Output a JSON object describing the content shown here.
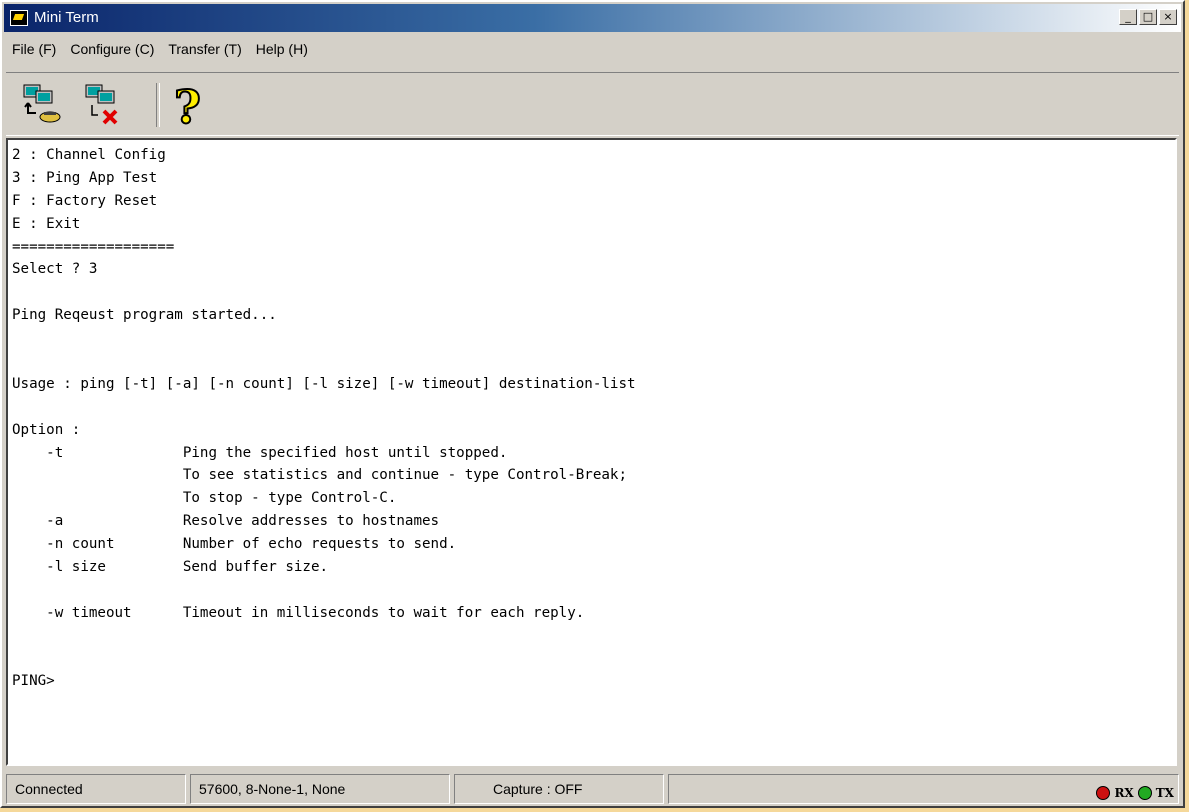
{
  "window": {
    "title": "Mini Term",
    "controls": [
      "_",
      "□",
      "×"
    ]
  },
  "menu": [
    {
      "label": "File (F)"
    },
    {
      "label": "Configure (C)"
    },
    {
      "label": "Transfer (T)"
    },
    {
      "label": "Help (H)"
    }
  ],
  "toolbar": {
    "buttons": [
      {
        "icon": "connect-icon"
      },
      {
        "icon": "disconnect-icon"
      },
      {
        "icon": "help-icon"
      }
    ]
  },
  "terminal": {
    "lines": [
      "2 : Channel Config",
      "3 : Ping App Test",
      "F : Factory Reset",
      "E : Exit",
      "===================",
      "Select ? 3",
      "",
      "Ping Reqeust program started...",
      "",
      "",
      "Usage : ping [-t] [-a] [-n count] [-l size] [-w timeout] destination-list",
      "",
      "Option :",
      "    -t              Ping the specified host until stopped.",
      "                    To see statistics and continue - type Control-Break;",
      "                    To stop - type Control-C.",
      "    -a              Resolve addresses to hostnames",
      "    -n count        Number of echo requests to send.",
      "    -l size         Send buffer size.",
      "",
      "    -w timeout      Timeout in milliseconds to wait for each reply.",
      "",
      "",
      "PING>"
    ]
  },
  "status": {
    "connection": "Connected",
    "settings": "57600,  8-None-1, None",
    "capture": "Capture : OFF",
    "rx_label": "RX",
    "tx_label": "TX",
    "colors": {
      "rx_led": "#cc1111",
      "tx_led": "#22aa22"
    }
  }
}
